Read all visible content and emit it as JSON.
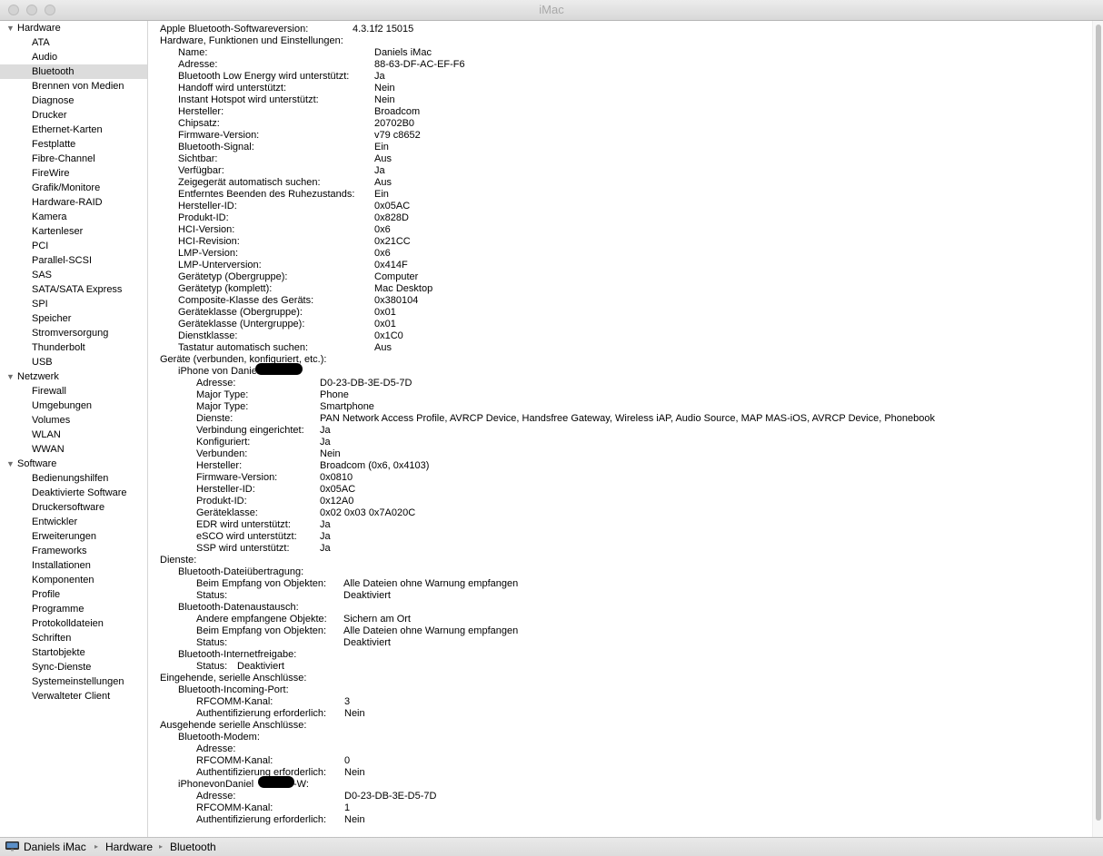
{
  "window": {
    "title": "iMac"
  },
  "sidebar": {
    "categories": [
      {
        "label": "Hardware",
        "items": [
          "ATA",
          "Audio",
          "Bluetooth",
          "Brennen von Medien",
          "Diagnose",
          "Drucker",
          "Ethernet-Karten",
          "Festplatte",
          "Fibre-Channel",
          "FireWire",
          "Grafik/Monitore",
          "Hardware-RAID",
          "Kamera",
          "Kartenleser",
          "PCI",
          "Parallel-SCSI",
          "SAS",
          "SATA/SATA Express",
          "SPI",
          "Speicher",
          "Stromversorgung",
          "Thunderbolt",
          "USB"
        ]
      },
      {
        "label": "Netzwerk",
        "items": [
          "Firewall",
          "Umgebungen",
          "Volumes",
          "WLAN",
          "WWAN"
        ]
      },
      {
        "label": "Software",
        "items": [
          "Bedienungshilfen",
          "Deaktivierte Software",
          "Druckersoftware",
          "Entwickler",
          "Erweiterungen",
          "Frameworks",
          "Installationen",
          "Komponenten",
          "Profile",
          "Programme",
          "Protokolldateien",
          "Schriften",
          "Startobjekte",
          "Sync-Dienste",
          "Systemeinstellungen",
          "Verwalteter Client"
        ]
      }
    ],
    "selected": "Bluetooth"
  },
  "lines": [
    {
      "k": "Apple Bluetooth-Softwareversion:",
      "v": "4.3.1f2 15015"
    },
    {
      "k": "Hardware, Funktionen und Einstellungen:",
      "v": ""
    },
    {
      "k": "Name:",
      "v": "Daniels iMac"
    },
    {
      "k": "Adresse:",
      "v": "88-63-DF-AC-EF-F6"
    },
    {
      "k": "Bluetooth Low Energy wird unterstützt:",
      "v": "Ja"
    },
    {
      "k": "Handoff wird unterstützt:",
      "v": "Nein"
    },
    {
      "k": "Instant Hotspot wird unterstützt:",
      "v": "Nein"
    },
    {
      "k": "Hersteller:",
      "v": "Broadcom"
    },
    {
      "k": "Chipsatz:",
      "v": "20702B0"
    },
    {
      "k": "Firmware-Version:",
      "v": "v79 c8652"
    },
    {
      "k": "Bluetooth-Signal:",
      "v": "Ein"
    },
    {
      "k": "Sichtbar:",
      "v": "Aus"
    },
    {
      "k": "Verfügbar:",
      "v": "Ja"
    },
    {
      "k": "Zeigegerät automatisch suchen:",
      "v": "Aus"
    },
    {
      "k": "Entferntes Beenden des Ruhezustands:",
      "v": "Ein"
    },
    {
      "k": "Hersteller-ID:",
      "v": "0x05AC"
    },
    {
      "k": "Produkt-ID:",
      "v": "0x828D"
    },
    {
      "k": "HCI-Version:",
      "v": "0x6"
    },
    {
      "k": "HCI-Revision:",
      "v": "0x21CC"
    },
    {
      "k": "LMP-Version:",
      "v": "0x6"
    },
    {
      "k": "LMP-Unterversion:",
      "v": "0x414F"
    },
    {
      "k": "Gerätetyp (Obergruppe):",
      "v": "Computer"
    },
    {
      "k": "Gerätetyp (komplett):",
      "v": "Mac Desktop"
    },
    {
      "k": "Composite-Klasse des Geräts:",
      "v": "0x380104"
    },
    {
      "k": "Geräteklasse (Obergruppe):",
      "v": "0x01"
    },
    {
      "k": "Geräteklasse (Untergruppe):",
      "v": "0x01"
    },
    {
      "k": "Dienstklasse:",
      "v": "0x1C0"
    },
    {
      "k": "Tastatur automatisch suchen:",
      "v": "Aus"
    },
    {
      "k": "Geräte (verbunden, konfiguriert, etc.):",
      "v": ""
    },
    {
      "k": "iPhone von Daniel",
      "v": ""
    },
    {
      "k": "Adresse:",
      "v": "D0-23-DB-3E-D5-7D"
    },
    {
      "k": "Major Type:",
      "v": "Phone"
    },
    {
      "k": "Major Type:",
      "v": "Smartphone"
    },
    {
      "k": "Dienste:",
      "v": "PAN Network Access Profile, AVRCP Device, Handsfree Gateway, Wireless iAP, Audio Source, MAP MAS-iOS, AVRCP Device, Phonebook"
    },
    {
      "k": "Verbindung eingerichtet:",
      "v": "Ja"
    },
    {
      "k": "Konfiguriert:",
      "v": "Ja"
    },
    {
      "k": "Verbunden:",
      "v": "Nein"
    },
    {
      "k": "Hersteller:",
      "v": "Broadcom (0x6, 0x4103)"
    },
    {
      "k": "Firmware-Version:",
      "v": "0x0810"
    },
    {
      "k": "Hersteller-ID:",
      "v": "0x05AC"
    },
    {
      "k": "Produkt-ID:",
      "v": "0x12A0"
    },
    {
      "k": "Geräteklasse:",
      "v": "0x02 0x03 0x7A020C"
    },
    {
      "k": "EDR wird unterstützt:",
      "v": "Ja"
    },
    {
      "k": "eSCO wird unterstützt:",
      "v": "Ja"
    },
    {
      "k": "SSP wird unterstützt:",
      "v": "Ja"
    },
    {
      "k": "Dienste:",
      "v": ""
    },
    {
      "k": "Bluetooth-Dateiübertragung:",
      "v": ""
    },
    {
      "k": "Beim Empfang von Objekten:",
      "v": "Alle Dateien ohne Warnung empfangen"
    },
    {
      "k": "Status:",
      "v": "Deaktiviert"
    },
    {
      "k": "Bluetooth-Datenaustausch:",
      "v": ""
    },
    {
      "k": "Andere empfangene Objekte:",
      "v": "Sichern am Ort"
    },
    {
      "k": "Beim Empfang von Objekten:",
      "v": "Alle Dateien ohne Warnung empfangen"
    },
    {
      "k": "Status:",
      "v": "Deaktiviert"
    },
    {
      "k": "Bluetooth-Internetfreigabe:",
      "v": ""
    },
    {
      "k": "Status:",
      "v": "Deaktiviert"
    },
    {
      "k": "Eingehende, serielle Anschlüsse:",
      "v": ""
    },
    {
      "k": "Bluetooth-Incoming-Port:",
      "v": ""
    },
    {
      "k": "RFCOMM-Kanal:",
      "v": "3"
    },
    {
      "k": "Authentifizierung erforderlich:",
      "v": "Nein"
    },
    {
      "k": "Ausgehende serielle Anschlüsse:",
      "v": ""
    },
    {
      "k": "Bluetooth-Modem:",
      "v": ""
    },
    {
      "k": "Adresse:",
      "v": ""
    },
    {
      "k": "RFCOMM-Kanal:",
      "v": "0"
    },
    {
      "k": "Authentifizierung erforderlich:",
      "v": "Nein"
    },
    {
      "k": "iPhonevonDaniel",
      "v": "-W:"
    },
    {
      "k": "Adresse:",
      "v": "D0-23-DB-3E-D5-7D"
    },
    {
      "k": "RFCOMM-Kanal:",
      "v": "1"
    },
    {
      "k": "Authentifizierung erforderlich:",
      "v": "Nein"
    }
  ],
  "statusbar": {
    "crumbs": [
      "Daniels iMac",
      "Hardware",
      "Bluetooth"
    ],
    "separator": "▸"
  }
}
